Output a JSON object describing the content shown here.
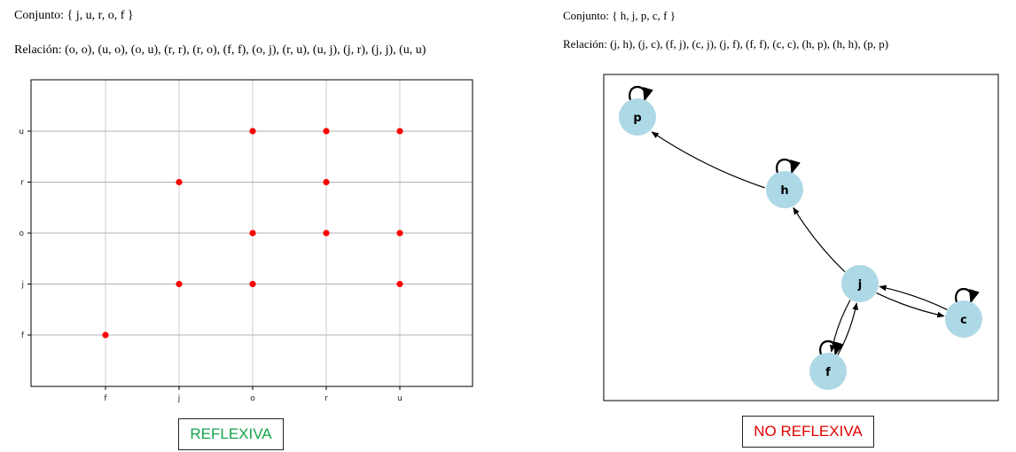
{
  "left": {
    "conjunto": "Conjunto: { j, u, r, o, f }",
    "relacion": "Relación: (o, o), (u, o), (o, u), (r, r), (r, o), (f, f), (o, j), (r, u), (u, j), (j, r), (j, j), (u, u)",
    "status": "REFLEXIVA",
    "status_color": "#16a34a"
  },
  "right": {
    "conjunto": "Conjunto: { h, j, p, c, f }",
    "relacion": "Relación: (j, h), (j, c), (f, j), (c, j), (j, f), (f, f), (c, c), (h, p), (h, h), (p, p)",
    "status": "NO REFLEXIVA",
    "status_color": "#e00000"
  },
  "chart_data": [
    {
      "type": "scatter",
      "title": "",
      "xlabel": "",
      "ylabel": "",
      "x_categories": [
        "f",
        "j",
        "o",
        "r",
        "u"
      ],
      "y_categories": [
        "f",
        "j",
        "o",
        "r",
        "u"
      ],
      "grid": true,
      "point_color": "#ff0000",
      "points": [
        [
          "o",
          "o"
        ],
        [
          "u",
          "o"
        ],
        [
          "o",
          "u"
        ],
        [
          "r",
          "r"
        ],
        [
          "r",
          "o"
        ],
        [
          "f",
          "f"
        ],
        [
          "o",
          "j"
        ],
        [
          "r",
          "u"
        ],
        [
          "u",
          "j"
        ],
        [
          "j",
          "r"
        ],
        [
          "j",
          "j"
        ],
        [
          "u",
          "u"
        ]
      ]
    },
    {
      "type": "graph",
      "node_color": "#add8e6",
      "nodes": [
        "p",
        "h",
        "j",
        "c",
        "f"
      ],
      "edges": [
        [
          "j",
          "h"
        ],
        [
          "j",
          "c"
        ],
        [
          "f",
          "j"
        ],
        [
          "c",
          "j"
        ],
        [
          "j",
          "f"
        ],
        [
          "f",
          "f"
        ],
        [
          "c",
          "c"
        ],
        [
          "h",
          "p"
        ],
        [
          "h",
          "h"
        ],
        [
          "p",
          "p"
        ]
      ]
    }
  ]
}
